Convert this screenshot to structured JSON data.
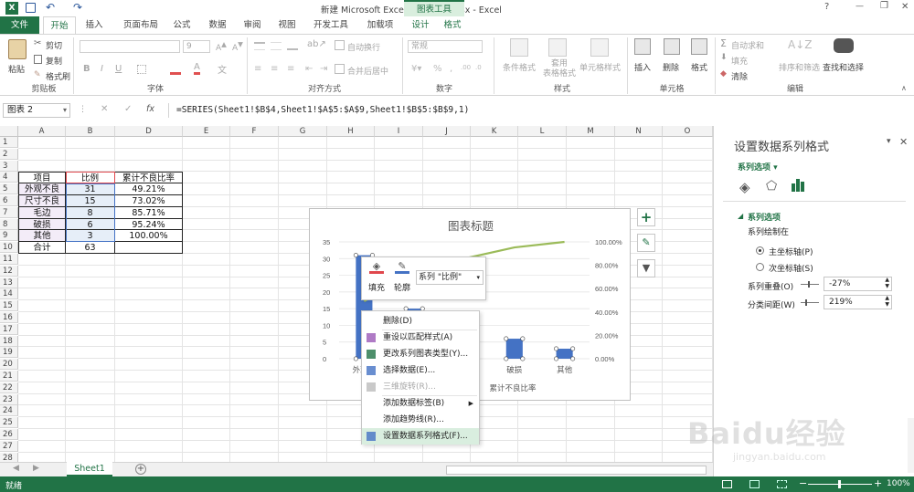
{
  "title": {
    "window_title": "新建 Microsoft Excel 工作表 (4).xlsx - Excel",
    "chart_tools": "图表工具",
    "help": "?",
    "minimize": "—",
    "restore": "❐",
    "close": "✕"
  },
  "tabs": [
    "文件",
    "开始",
    "插入",
    "页面布局",
    "公式",
    "数据",
    "审阅",
    "视图",
    "开发工具",
    "加载项",
    "设计",
    "格式"
  ],
  "ribbon": {
    "clipboard": {
      "paste": "粘贴",
      "cut": "剪切",
      "copy": "复制",
      "format_painter": "格式刷",
      "label": "剪贴板"
    },
    "font": {
      "size": "9",
      "label": "字体"
    },
    "alignment": {
      "wrap": "自动换行",
      "merge": "合并后居中",
      "label": "对齐方式"
    },
    "number": {
      "format": "常规",
      "label": "数字"
    },
    "styles": {
      "conditional": "条件格式",
      "table": "套用\n表格格式",
      "cell_styles": "单元格样式",
      "label": "样式"
    },
    "cells": {
      "insert": "插入",
      "delete": "删除",
      "format": "格式",
      "label": "单元格"
    },
    "editing": {
      "autosum": "自动求和",
      "fill": "填充",
      "clear": "清除",
      "sort": "排序和筛选",
      "find": "查找和选择",
      "label": "编辑"
    }
  },
  "formula_bar": {
    "name_box": "图表 2",
    "fx": "fx",
    "formula": "=SERIES(Sheet1!$B$4,Sheet1!$A$5:$A$9,Sheet1!$B$5:$B$9,1)"
  },
  "columns": [
    "A",
    "B",
    "D",
    "E",
    "F",
    "G",
    "H",
    "I",
    "J",
    "K",
    "L",
    "M",
    "N",
    "O"
  ],
  "rows": [
    "1",
    "2",
    "3",
    "4",
    "5",
    "6",
    "7",
    "8",
    "9",
    "10",
    "11",
    "12",
    "13",
    "14",
    "15",
    "16",
    "17",
    "18",
    "19",
    "20",
    "21",
    "22",
    "23",
    "24",
    "25",
    "26",
    "27",
    "28"
  ],
  "table": {
    "headers": [
      "项目",
      "比例",
      "累计不良比率"
    ],
    "rows": [
      [
        "外观不良",
        "31",
        "49.21%"
      ],
      [
        "尺寸不良",
        "15",
        "73.02%"
      ],
      [
        "毛边",
        "8",
        "85.71%"
      ],
      [
        "破损",
        "6",
        "95.24%"
      ],
      [
        "其他",
        "3",
        "100.00%"
      ],
      [
        "合计",
        "63",
        ""
      ]
    ]
  },
  "chart_data": {
    "type": "bar",
    "title": "图表标题",
    "categories": [
      "外观不良",
      "尺寸不良",
      "毛边",
      "破损",
      "其他"
    ],
    "visible_category_labels": [
      "外观不",
      "",
      "",
      "破损",
      "其他"
    ],
    "series": [
      {
        "name": "比例",
        "values": [
          31,
          15,
          8,
          6,
          3
        ],
        "axis": "primary",
        "color": "#4472c4"
      },
      {
        "name": "累计不良比率",
        "values": [
          0.4921,
          0.7302,
          0.8571,
          0.9524,
          1.0
        ],
        "axis": "secondary",
        "type": "line",
        "color": "#9bbb59"
      }
    ],
    "ylim": [
      0,
      35
    ],
    "yticks": [
      "0",
      "5",
      "10",
      "15",
      "20",
      "25",
      "30",
      "35"
    ],
    "y2lim": [
      0,
      1
    ],
    "y2ticks": [
      "0.00%",
      "20.00%",
      "40.00%",
      "60.00%",
      "80.00%",
      "100.00%"
    ],
    "legend_partial": "累计不良比率"
  },
  "mini_toolbar": {
    "fill": "填充",
    "outline": "轮廓",
    "series_select": "系列 \"比例\""
  },
  "context_menu": [
    {
      "label": "删除(D)",
      "enabled": true,
      "icon": ""
    },
    {
      "label": "重设以匹配样式(A)",
      "enabled": true,
      "icon": "reset"
    },
    {
      "label": "更改系列图表类型(Y)...",
      "enabled": true,
      "icon": "chart"
    },
    {
      "label": "选择数据(E)...",
      "enabled": true,
      "icon": "data"
    },
    {
      "label": "三维旋转(R)...",
      "enabled": false,
      "icon": "rotate"
    },
    {
      "label": "添加数据标签(B)",
      "enabled": true,
      "icon": "",
      "submenu": true
    },
    {
      "label": "添加趋势线(R)...",
      "enabled": true,
      "icon": ""
    },
    {
      "label": "设置数据系列格式(F)...",
      "enabled": true,
      "icon": "format",
      "highlighted": true
    }
  ],
  "pane": {
    "title": "设置数据系列格式",
    "subtitle": "系列选项",
    "section": "系列选项",
    "plot_on": "系列绘制在",
    "primary": "主坐标轴(P)",
    "secondary": "次坐标轴(S)",
    "overlap_label": "系列重叠(O)",
    "overlap_value": "-27%",
    "gap_label": "分类间距(W)",
    "gap_value": "219%"
  },
  "sheet_tab": "Sheet1",
  "status": {
    "ready": "就绪",
    "zoom": "100%"
  },
  "watermark": {
    "brand": "Baidu经验",
    "url": "jingyan.baidu.com"
  },
  "colors": {
    "excel_green": "#217346",
    "accent": "#2e75b6"
  }
}
